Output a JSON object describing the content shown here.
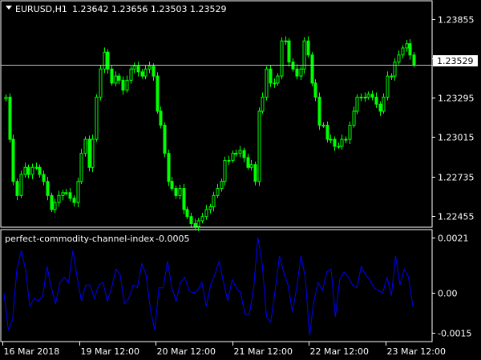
{
  "main_chart": {
    "symbol_tf": "EURUSD,H1",
    "ohlc": "1.23642 1.23656 1.23503 1.23529",
    "current_price_label": "1.23529",
    "candle_color": "#00ff00",
    "price_line_color": "#c0c0c0"
  },
  "indicator": {
    "name": "perfect-commodity-channel-index",
    "value": "-0.0005",
    "line_color": "#0000ff"
  },
  "time_axis": {
    "labels": [
      "16 Mar 2018",
      "19 Mar 12:00",
      "20 Mar 12:00",
      "21 Mar 12:00",
      "22 Mar 12:00",
      "23 Mar 12:00"
    ]
  },
  "chart_data": [
    {
      "type": "candlestick",
      "title": "EURUSD,H1",
      "price_ticks": [
        "1.23855",
        "1.23575",
        "1.23295",
        "1.23015",
        "1.22735",
        "1.22455"
      ],
      "ylim": [
        1.2238,
        1.2398
      ],
      "current_price": 1.23529,
      "x_labels": [
        "16 Mar 2018",
        "19 Mar 12:00",
        "20 Mar 12:00",
        "21 Mar 12:00",
        "22 Mar 12:00",
        "23 Mar 12:00"
      ],
      "series": [
        {
          "values": [
            1.233,
            1.23,
            1.227,
            1.226,
            1.2275,
            1.228,
            1.2275,
            1.228,
            1.228,
            1.2275,
            1.227,
            1.226,
            1.225,
            1.2255,
            1.226,
            1.2262,
            1.2262,
            1.2258,
            1.2255,
            1.227,
            1.229,
            1.23,
            1.228,
            1.23,
            1.233,
            1.235,
            1.2362,
            1.235,
            1.234,
            1.2345,
            1.2342,
            1.2335,
            1.2342,
            1.235,
            1.2352,
            1.2348,
            1.2345,
            1.235,
            1.2352,
            1.2345,
            1.232,
            1.231,
            1.229,
            1.227,
            1.2265,
            1.226,
            1.2265,
            1.225,
            1.2245,
            1.224,
            1.2238,
            1.2242,
            1.2245,
            1.225,
            1.2252,
            1.226,
            1.2265,
            1.227,
            1.2285,
            1.2285,
            1.229,
            1.229,
            1.2292,
            1.2287,
            1.228,
            1.2282,
            1.227,
            1.232,
            1.233,
            1.235,
            1.234,
            1.234,
            1.2345,
            1.237,
            1.237,
            1.2355,
            1.235,
            1.2345,
            1.235,
            1.237,
            1.236,
            1.234,
            1.233,
            1.231,
            1.231,
            1.23,
            1.23,
            1.2295,
            1.2295,
            1.23,
            1.23,
            1.231,
            1.232,
            1.233,
            1.233,
            1.233,
            1.2332,
            1.233,
            1.2325,
            1.232,
            1.233,
            1.2345,
            1.2345,
            1.2355,
            1.236,
            1.2365,
            1.2368,
            1.236,
            1.2353
          ]
        }
      ]
    },
    {
      "type": "line",
      "title": "perfect-commodity-channel-index -0.0005",
      "y_ticks": [
        "0.0021",
        "0.00",
        "-0.0015"
      ],
      "ylim": [
        -0.0018,
        0.0023
      ],
      "x_labels": [
        "16 Mar 2018",
        "19 Mar 12:00",
        "20 Mar 12:00",
        "21 Mar 12:00",
        "22 Mar 12:00",
        "23 Mar 12:00"
      ],
      "series": [
        {
          "values": [
            0.0,
            -0.0014,
            -0.001,
            0.0009,
            0.0016,
            0.0009,
            -0.0005,
            -0.0002,
            -0.0003,
            -0.0001,
            0.001,
            0.0002,
            -0.0004,
            0.0004,
            0.0006,
            0.0004,
            0.0016,
            0.0006,
            -0.0003,
            0.0003,
            0.0003,
            -0.0002,
            0.0003,
            0.0004,
            -0.0003,
            0.0002,
            0.0009,
            0.0007,
            -0.0004,
            -0.0002,
            0.0003,
            0.0002,
            0.0011,
            0.0007,
            -0.0006,
            -0.0014,
            0.0002,
            0.0002,
            0.0012,
            0.0002,
            -0.0003,
            0.0004,
            0.0006,
            0.0001,
            0.0,
            0.0001,
            0.0004,
            -0.0005,
            0.0003,
            0.0007,
            0.0012,
            0.0004,
            -0.0003,
            0.0005,
            0.0002,
            0.0,
            -0.0008,
            -0.0008,
            0.0002,
            0.0021,
            0.0011,
            -0.0009,
            -0.0011,
            0.0001,
            0.0014,
            0.0008,
            0.0003,
            -0.0007,
            0.0002,
            0.0014,
            0.0006,
            -0.0016,
            -0.0003,
            0.0004,
            0.0001,
            0.0008,
            0.0009,
            -0.0009,
            0.0005,
            0.0008,
            0.0006,
            0.0003,
            0.0002,
            0.001,
            0.0007,
            0.0005,
            0.0002,
            0.0001,
            0.0,
            0.0006,
            -0.0001,
            0.0014,
            0.0003,
            0.0009,
            0.0006,
            -0.0005
          ]
        }
      ]
    }
  ]
}
